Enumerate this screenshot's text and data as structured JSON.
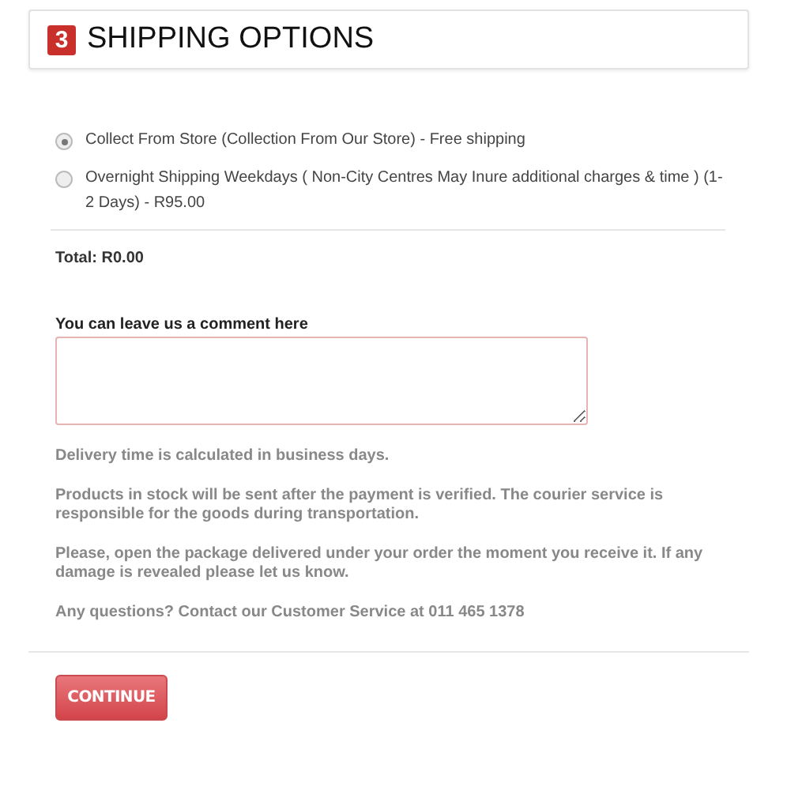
{
  "header": {
    "step": "3",
    "title": "SHIPPING OPTIONS"
  },
  "shipping_options": [
    {
      "label": "Collect From Store (Collection From Our Store) - Free shipping",
      "selected": true
    },
    {
      "label": "Overnight Shipping Weekdays ( Non-City Centres May Inure additional charges & time ) (1-2 Days) - R95.00",
      "selected": false
    }
  ],
  "total": "Total: R0.00",
  "comment": {
    "label": "You can leave us a comment here"
  },
  "notes": [
    "Delivery time is calculated in business days.",
    "Products in stock will be sent after the payment is verified. The courier service is responsible for the goods during transportation.",
    "Please, open the package delivered under your order the moment you receive it. If any damage is revealed please let us know.",
    "Any questions? Contact our Customer Service at 011 465 1378"
  ],
  "button": "CONTINUE"
}
